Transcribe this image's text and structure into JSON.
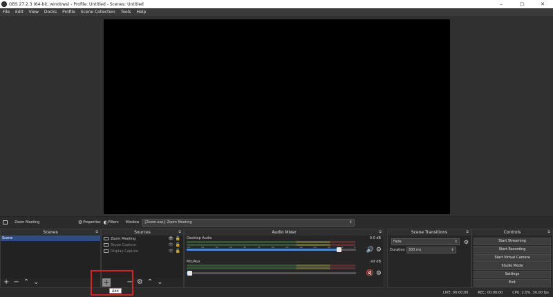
{
  "window": {
    "title": "OBS 27.2.3 (64-bit, windows) - Profile: Untitled - Scenes: Untitled",
    "minimize": "–",
    "maximize": "▢",
    "close": "✕"
  },
  "menu": [
    "File",
    "Edit",
    "View",
    "Docks",
    "Profile",
    "Scene Collection",
    "Tools",
    "Help"
  ],
  "context_bar": {
    "source_name": "Zoom Meeting",
    "properties_label": "Properties",
    "filters_label": "Filters",
    "window_label": "Window",
    "window_value": "[Zoom.exe]: Zoom Meeting"
  },
  "scenes": {
    "header": "Scenes",
    "items": [
      "Scene"
    ]
  },
  "sources": {
    "header": "Sources",
    "items": [
      {
        "name": "Zoom Meeting",
        "dim": false
      },
      {
        "name": "Skype Capture",
        "dim": true
      },
      {
        "name": "Display Capture",
        "dim": true
      }
    ],
    "add_tooltip": "Add"
  },
  "mixer": {
    "header": "Audio Mixer",
    "ticks": [
      "-60",
      "-55",
      "-50",
      "-45",
      "-40",
      "-35",
      "-30",
      "-25",
      "-20",
      "-15",
      "-10",
      "-5",
      "0"
    ],
    "channels": [
      {
        "name": "Desktop Audio",
        "db": "0.0 dB",
        "volume": 0.9,
        "muted": false
      },
      {
        "name": "Mic/Aux",
        "db": "-inf dB",
        "volume": 0.02,
        "muted": true
      }
    ]
  },
  "transitions": {
    "header": "Scene Transitions",
    "type": "Fade",
    "duration_label": "Duration",
    "duration_value": "300 ms"
  },
  "controls": {
    "header": "Controls",
    "buttons": [
      "Start Streaming",
      "Start Recording",
      "Start Virtual Camera",
      "Studio Mode",
      "Settings",
      "Exit"
    ]
  },
  "status": {
    "live": "LIVE: 00:00:00",
    "rec": "REC: 00:00:00",
    "cpu": "CPU: 2.0%, 30.00 fps"
  },
  "colors": {
    "accent": "#2e4d86",
    "highlight": "#e02020",
    "muted": "#e03030"
  }
}
